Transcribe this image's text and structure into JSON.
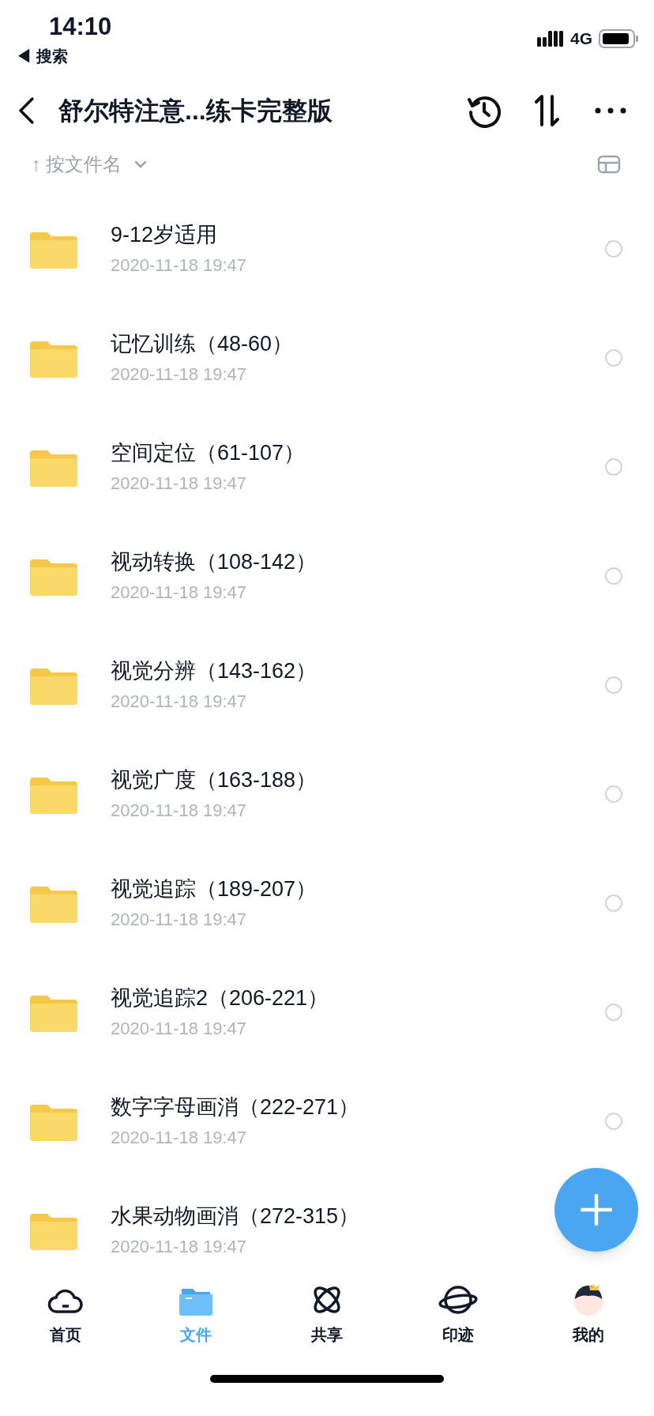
{
  "status_bar": {
    "time": "14:10",
    "network": "4G",
    "back_app": "◀ 搜索"
  },
  "header": {
    "title": "舒尔特注意...练卡完整版"
  },
  "sort": {
    "label": "按文件名",
    "arrow": "↑"
  },
  "files": [
    {
      "name": "9-12岁适用",
      "date": "2020-11-18 19:47",
      "selected": false
    },
    {
      "name": "记忆训练（48-60）",
      "date": "2020-11-18 19:47",
      "selected": false
    },
    {
      "name": "空间定位（61-107）",
      "date": "2020-11-18 19:47",
      "selected": false
    },
    {
      "name": "视动转换（108-142）",
      "date": "2020-11-18 19:47",
      "selected": false
    },
    {
      "name": "视觉分辨（143-162）",
      "date": "2020-11-18 19:47",
      "selected": false
    },
    {
      "name": "视觉广度（163-188）",
      "date": "2020-11-18 19:47",
      "selected": false
    },
    {
      "name": "视觉追踪（189-207）",
      "date": "2020-11-18 19:47",
      "selected": false
    },
    {
      "name": "视觉追踪2（206-221）",
      "date": "2020-11-18 19:47",
      "selected": false
    },
    {
      "name": "数字字母画消（222-271）",
      "date": "2020-11-18 19:47",
      "selected": false
    },
    {
      "name": "水果动物画消（272-315）",
      "date": "2020-11-18 19:47"
    }
  ],
  "tabs": [
    {
      "label": "首页",
      "kind": "cloud",
      "selected": false
    },
    {
      "label": "文件",
      "kind": "folder",
      "selected": true
    },
    {
      "label": "共享",
      "kind": "atom",
      "selected": false
    },
    {
      "label": "印迹",
      "kind": "planet",
      "selected": false
    },
    {
      "label": "我的",
      "kind": "avatar",
      "selected": false
    }
  ]
}
